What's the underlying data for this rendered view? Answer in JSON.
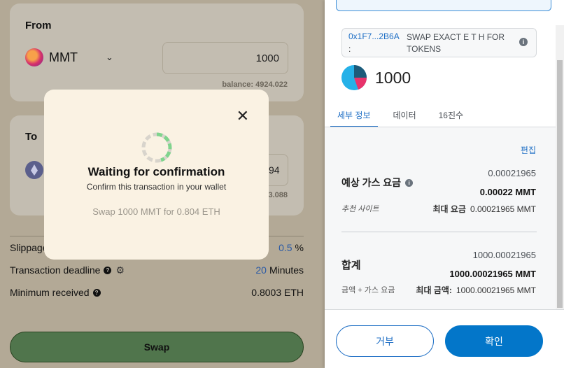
{
  "swap": {
    "from": {
      "title": "From",
      "token": "MMT",
      "token_icon": "mmt-token-icon",
      "amount": "1000",
      "balance": "balance: 4924.022"
    },
    "to": {
      "title": "To",
      "token_icon": "eth-token-icon",
      "amount_partial": "94",
      "balance_partial": "3.088"
    },
    "settings": {
      "slippage_label": "Slippage",
      "slippage_value": "0.5",
      "slippage_unit": "%",
      "deadline_label": "Transaction deadline",
      "deadline_value": "20",
      "deadline_unit": "Minutes",
      "min_received_label": "Minimum received",
      "min_received_value": "0.8003 ETH"
    },
    "swap_button": "Swap"
  },
  "modal": {
    "title": "Waiting for confirmation",
    "subtitle": "Confirm this transaction in your wallet",
    "detail": "Swap 1000 MMT for 0.804 ETH",
    "close_icon": "close-icon"
  },
  "metamask": {
    "address": "0x1F7...2B6A",
    "address_suffix": ":",
    "method": "SWAP EXACT E T H FOR TOKENS",
    "amount": "1000",
    "tabs": [
      "세부 정보",
      "데이터",
      "16진수"
    ],
    "edit": "편집",
    "gas": {
      "label": "예상 가스 요금",
      "amount": "0.00021965",
      "amount_bold": "0.00022 MMT",
      "site": "추천 사이트",
      "max_label": "최대 요금",
      "max_value": "0.00021965 MMT"
    },
    "total": {
      "label": "합계",
      "amount": "1000.00021965",
      "amount_bold": "1000.00021965 MMT",
      "amount_gas": "금액 + 가스 요금",
      "max_label": "최대 금액:",
      "max_value": "1000.00021965 MMT"
    },
    "reject": "거부",
    "confirm": "확인",
    "colors": {
      "accent": "#1f6fc5",
      "confirm_bg": "#0376c9"
    }
  }
}
